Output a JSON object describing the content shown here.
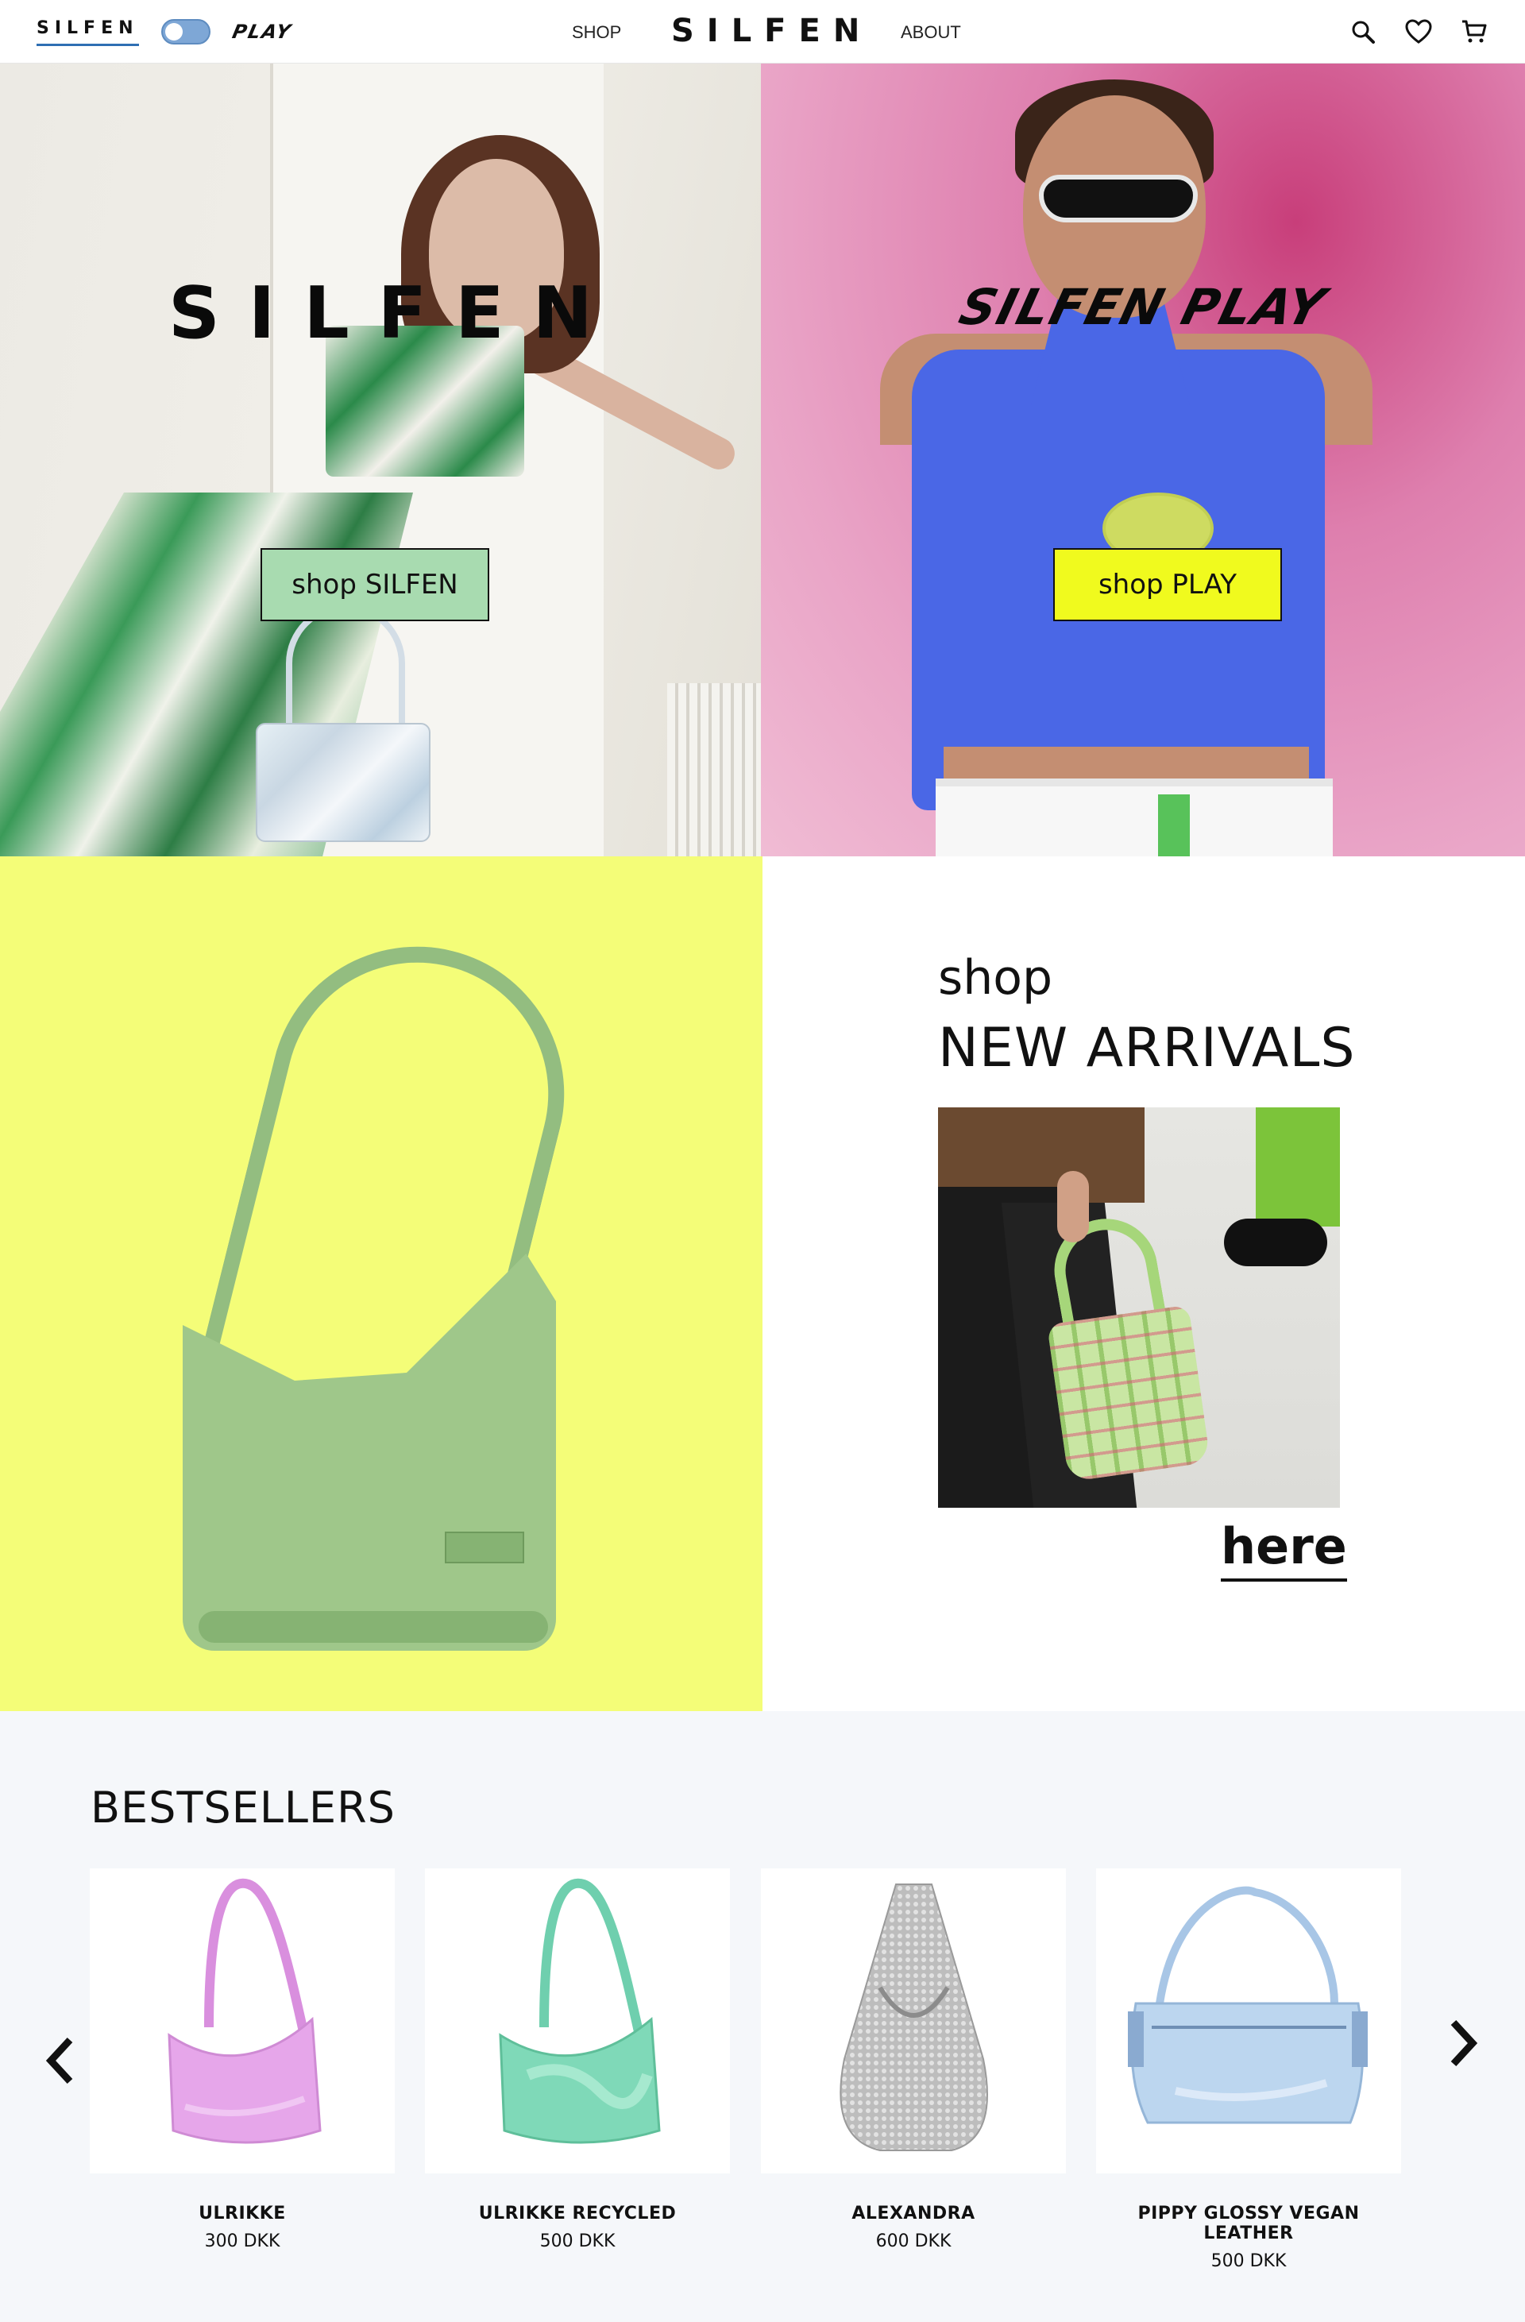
{
  "header": {
    "brand_left": "SILFEN",
    "brand_right": "PLAY",
    "nav_shop": "SHOP",
    "logo": "SILFEN",
    "nav_about": "ABOUT",
    "icons": [
      "search-icon",
      "heart-icon",
      "cart-icon"
    ],
    "accent_color": "#2f6fb3"
  },
  "hero": {
    "left": {
      "logo": "SILFEN",
      "button": "shop SILFEN",
      "button_color": "#a8dbb0"
    },
    "right": {
      "logo": "SILFEN PLAY",
      "button": "shop PLAY",
      "button_color": "#f0fa1e"
    }
  },
  "new_arrivals": {
    "kicker": "shop",
    "title": "NEW ARRIVALS",
    "link": "here",
    "panel_color": "#f4fd78"
  },
  "bestsellers": {
    "title": "BESTSELLERS",
    "prev_icon": "chevron-left-icon",
    "next_icon": "chevron-right-icon",
    "products": [
      {
        "name": "ULRIKKE",
        "price": "300 DKK",
        "color": "#e6a6ea"
      },
      {
        "name": "ULRIKKE RECYCLED",
        "price": "500 DKK",
        "color": "#7fd9b8"
      },
      {
        "name": "ALEXANDRA",
        "price": "600 DKK",
        "color": "#c8c8c8"
      },
      {
        "name": "PIPPY GLOSSY VEGAN LEATHER",
        "price": "500 DKK",
        "color": "#bcd6ef"
      }
    ]
  }
}
